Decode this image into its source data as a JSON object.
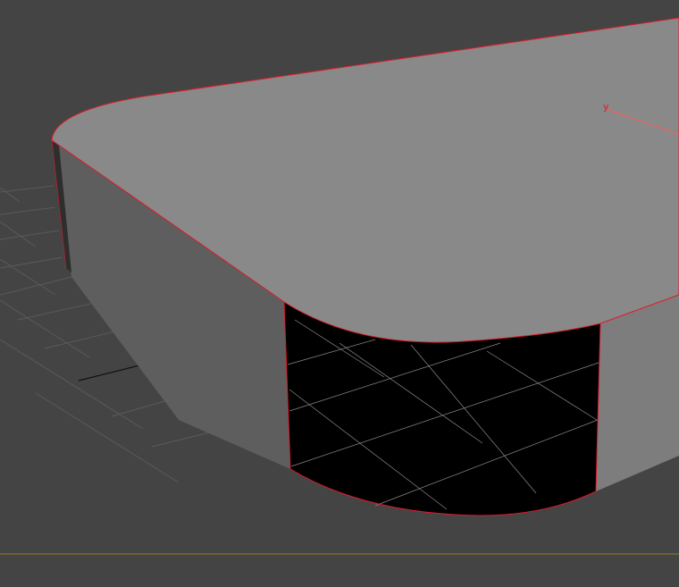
{
  "viewport": {
    "background_color": "#444444",
    "grid_color": "#5a5a5a",
    "grid_major_color": "#111111",
    "cutout_grid_color": "#8a8a8a",
    "object_top_color": "#898989",
    "object_side_color": "#5e5e5e",
    "object_right_side_color": "#7d7d7d",
    "cutout_color": "#000000",
    "selection_edge_color": "#e0182a",
    "axis_x_color": "#ff5a5a",
    "axis_y_label": "y",
    "axis_y_label_color": "#e0182a",
    "world_axis_color": "#8a6f2a"
  }
}
